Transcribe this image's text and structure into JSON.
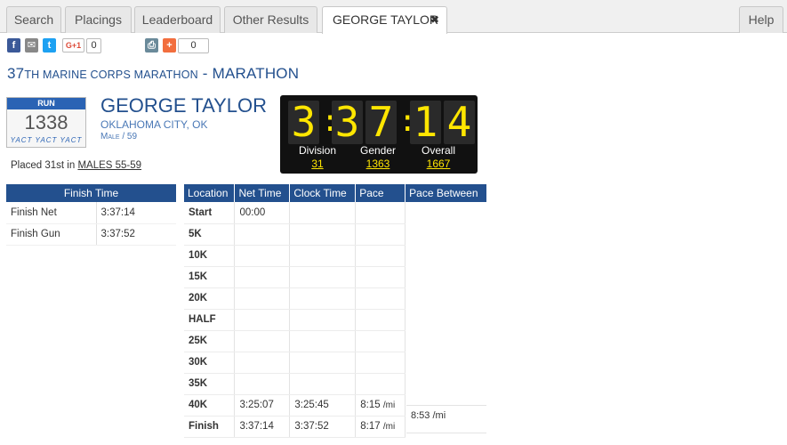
{
  "tabs": [
    {
      "label": "Search"
    },
    {
      "label": "Placings"
    },
    {
      "label": "Leaderboard"
    },
    {
      "label": "Other Results"
    },
    {
      "label": "GEORGE TAYLOR",
      "close": "✖"
    }
  ],
  "help_label": "Help",
  "share": {
    "gplus_label": "G+1",
    "gplus_count": "0",
    "add_count": "0"
  },
  "event": {
    "title_prefix": "37",
    "title_prefix_sc": "TH MARINE CORPS MARATHON",
    "title_suffix": " - MARATHON"
  },
  "bib": {
    "label": "RUN",
    "number": "1338",
    "brand": "YACT YACT YACT"
  },
  "runner": {
    "name": "GEORGE TAYLOR",
    "city": "OKLAHOMA CITY, OK",
    "gender_age": "Male / 59",
    "placed_prefix": "Placed 31st in ",
    "placed_division": "MALES 55-59"
  },
  "scoreboard": {
    "digits": [
      "3",
      ":",
      "3",
      "7",
      ":",
      "1",
      "4"
    ],
    "division_label": "Division",
    "division_value": "31",
    "gender_label": "Gender",
    "gender_value": "1363",
    "overall_label": "Overall",
    "overall_value": "1667"
  },
  "finish_table": {
    "header": "Finish Time",
    "rows": [
      {
        "label": "Finish Net",
        "value": "3:37:14"
      },
      {
        "label": "Finish Gun",
        "value": "3:37:52"
      }
    ]
  },
  "splits_table": {
    "headers": [
      "Location",
      "Net Time",
      "Clock Time",
      "Pace",
      "Pace Between"
    ],
    "rows": [
      {
        "loc": "Start",
        "net": "00:00",
        "clock": "",
        "pace": "",
        "unit": ""
      },
      {
        "loc": "5K",
        "net": "",
        "clock": "",
        "pace": "",
        "unit": ""
      },
      {
        "loc": "10K",
        "net": "",
        "clock": "",
        "pace": "",
        "unit": ""
      },
      {
        "loc": "15K",
        "net": "",
        "clock": "",
        "pace": "",
        "unit": ""
      },
      {
        "loc": "20K",
        "net": "",
        "clock": "",
        "pace": "",
        "unit": ""
      },
      {
        "loc": "HALF",
        "net": "",
        "clock": "",
        "pace": "",
        "unit": ""
      },
      {
        "loc": "25K",
        "net": "",
        "clock": "",
        "pace": "",
        "unit": ""
      },
      {
        "loc": "30K",
        "net": "",
        "clock": "",
        "pace": "",
        "unit": ""
      },
      {
        "loc": "35K",
        "net": "",
        "clock": "",
        "pace": "",
        "unit": ""
      },
      {
        "loc": "40K",
        "net": "3:25:07",
        "clock": "3:25:45",
        "pace": "8:15",
        "unit": "/mi"
      },
      {
        "loc": "Finish",
        "net": "3:37:14",
        "clock": "3:37:52",
        "pace": "8:17",
        "unit": "/mi"
      }
    ],
    "pace_between": "8:53",
    "pace_between_unit": "/mi"
  },
  "colors": {
    "brand_blue": "#23508e",
    "board_yellow": "#ffe600"
  }
}
